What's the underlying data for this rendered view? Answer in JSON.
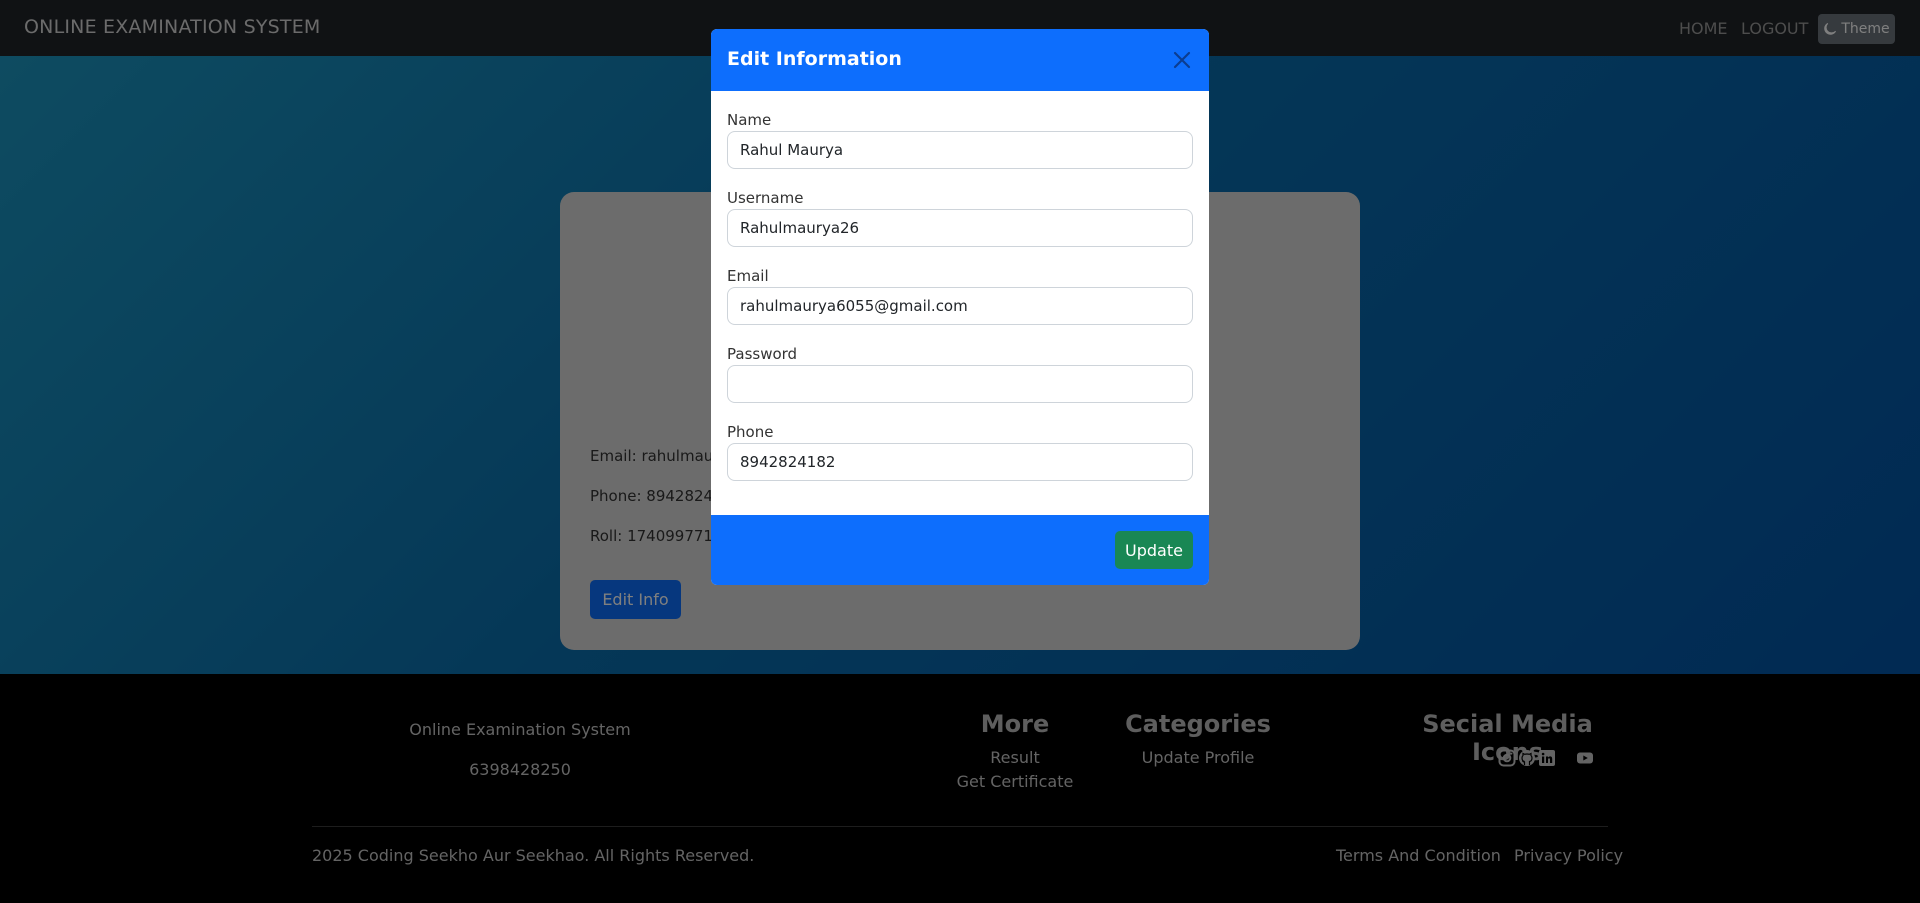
{
  "navbar": {
    "brand": "ONLINE EXAMINATION SYSTEM",
    "home": "HOME",
    "logout": "LOGOUT",
    "theme": "Theme"
  },
  "profile": {
    "email": "Email: rahulmaurya6055@gmail.com",
    "phone": "Phone: 8942824182",
    "roll": "Roll: 1740997712",
    "edit_button": "Edit Info"
  },
  "modal": {
    "title": "Edit Information",
    "fields": [
      {
        "label": "Name",
        "value": "Rahul Maurya"
      },
      {
        "label": "Username",
        "value": "Rahulmaurya26"
      },
      {
        "label": "Email",
        "value": "rahulmaurya6055@gmail.com"
      },
      {
        "label": "Password",
        "value": ""
      },
      {
        "label": "Phone",
        "value": "8942824182"
      }
    ],
    "update_button": "Update"
  },
  "footer": {
    "brand": "Online Examination System",
    "phone": "6398428250",
    "more_heading": "More",
    "more_links": [
      "Result",
      "Get Certificate"
    ],
    "categories_heading": "Categories",
    "categories_links": [
      "Update Profile"
    ],
    "social_heading": "Secial Media Icons",
    "social_icons": [
      "instagram-icon",
      "github-icon",
      "linkedin-icon",
      "youtube-icon"
    ],
    "copyright": "2025 Coding Seekho Aur Seekhao. All Rights Reserved.",
    "terms": "Terms And Condition",
    "privacy": "Privacy Policy"
  },
  "colors": {
    "primary": "#0d6efd",
    "success": "#198754",
    "navbar": "#212529"
  }
}
